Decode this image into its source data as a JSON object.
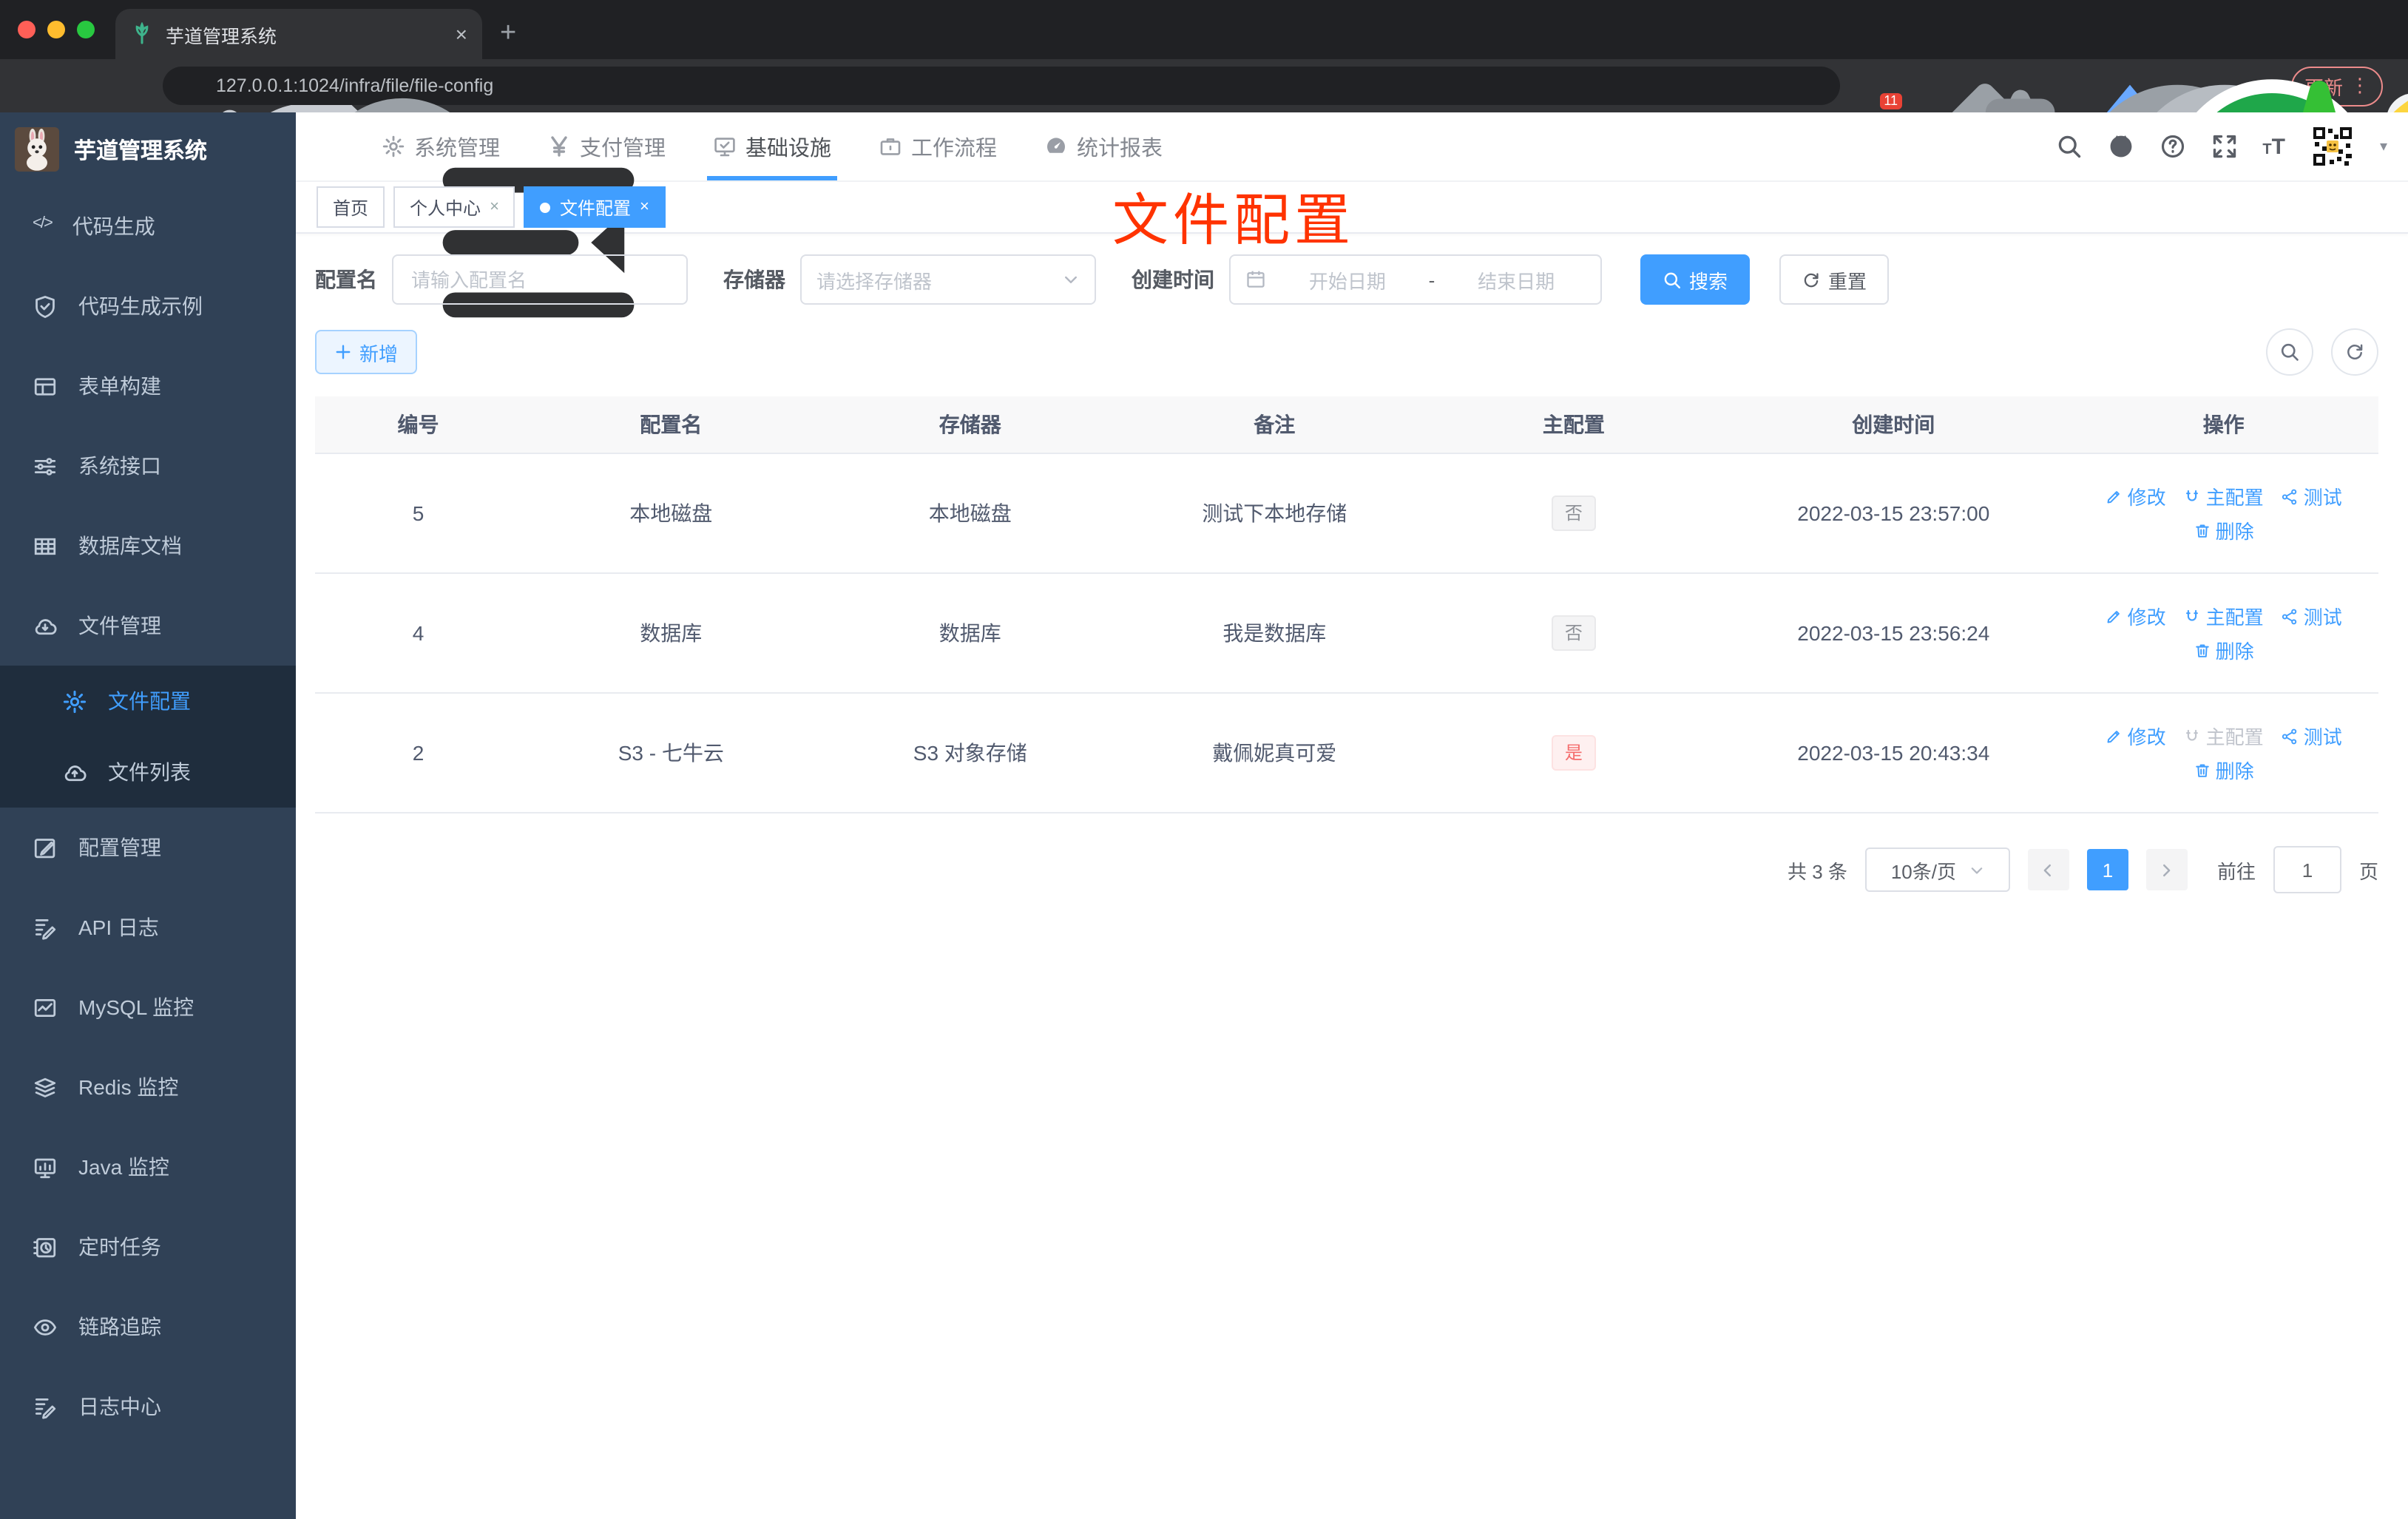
{
  "browser": {
    "tab_title": "芋道管理系统",
    "tab_close": "×",
    "new_tab": "+",
    "url": "127.0.0.1:1024/infra/file/file-config",
    "extension_badge": "11",
    "update_label": "更新",
    "kebab": "⋮",
    "traffic_colors": {
      "close": "#ff5f57",
      "minimize": "#febc2e",
      "zoom": "#28c840"
    }
  },
  "header": {
    "nav": [
      {
        "label": "系统管理",
        "icon": "gear-icon"
      },
      {
        "label": "支付管理",
        "icon": "yen-icon"
      },
      {
        "label": "基础设施",
        "icon": "monitor-check-icon",
        "active": true
      },
      {
        "label": "工作流程",
        "icon": "briefcase-icon"
      },
      {
        "label": "统计报表",
        "icon": "gauge-icon"
      }
    ]
  },
  "tabs": [
    {
      "label": "首页"
    },
    {
      "label": "个人中心",
      "close": "×"
    },
    {
      "label": "文件配置",
      "close": "×",
      "active": true
    }
  ],
  "annotation": {
    "text": "文件配置",
    "color": "#ff3300"
  },
  "sidebar": {
    "title": "芋道管理系统",
    "items": [
      {
        "label": "代码生成",
        "icon": "code-icon"
      },
      {
        "label": "代码生成示例",
        "icon": "shield-check-icon"
      },
      {
        "label": "表单构建",
        "icon": "form-grid-icon"
      },
      {
        "label": "系统接口",
        "icon": "sliders-icon"
      },
      {
        "label": "数据库文档",
        "icon": "table-grid-icon"
      },
      {
        "label": "文件管理",
        "icon": "cloud-download-icon",
        "expanded": true,
        "children": [
          {
            "label": "文件配置",
            "icon": "gear-icon",
            "active": true
          },
          {
            "label": "文件列表",
            "icon": "cloud-upload-icon"
          }
        ]
      },
      {
        "label": "配置管理",
        "icon": "edit-square-icon"
      },
      {
        "label": "API 日志",
        "icon": "doc-edit-icon",
        "collapsed": true
      },
      {
        "label": "MySQL 监控",
        "icon": "chart-line-icon"
      },
      {
        "label": "Redis 监控",
        "icon": "layers-icon"
      },
      {
        "label": "Java 监控",
        "icon": "monitor-bars-icon"
      },
      {
        "label": "定时任务",
        "icon": "schedule-icon"
      },
      {
        "label": "链路追踪",
        "icon": "eye-icon"
      },
      {
        "label": "日志中心",
        "icon": "log-edit-icon"
      }
    ]
  },
  "filters": {
    "name_label": "配置名",
    "name_placeholder": "请输入配置名",
    "storage_label": "存储器",
    "storage_placeholder": "请选择存储器",
    "date_label": "创建时间",
    "date_start": "开始日期",
    "date_sep": "-",
    "date_end": "结束日期",
    "search": "搜索",
    "reset": "重置"
  },
  "toolbar": {
    "add": "新增"
  },
  "table": {
    "headers": [
      "编号",
      "配置名",
      "存储器",
      "备注",
      "主配置",
      "创建时间",
      "操作"
    ],
    "action_labels": {
      "edit": "修改",
      "master": "主配置",
      "test": "测试",
      "delete": "删除"
    },
    "rows": [
      {
        "id": "5",
        "name": "本地磁盘",
        "storage": "本地磁盘",
        "remark": "测试下本地存储",
        "master": "否",
        "master_type": "info",
        "created": "2022-03-15 23:57:00",
        "master_action_disabled": false
      },
      {
        "id": "4",
        "name": "数据库",
        "storage": "数据库",
        "remark": "我是数据库",
        "master": "否",
        "master_type": "info",
        "created": "2022-03-15 23:56:24",
        "master_action_disabled": false
      },
      {
        "id": "2",
        "name": "S3 - 七牛云",
        "storage": "S3 对象存储",
        "remark": "戴佩妮真可爱",
        "master": "是",
        "master_type": "danger",
        "created": "2022-03-15 20:43:34",
        "master_action_disabled": true
      }
    ]
  },
  "pagination": {
    "total": "共 3 条",
    "page_size": "10条/页",
    "current": "1",
    "goto": "前往",
    "page_value": "1",
    "page_suffix": "页"
  },
  "colors": {
    "primary": "#409eff",
    "danger": "#f56c6c",
    "sidebar_bg": "#304156",
    "submenu_bg": "#1f2d3d"
  }
}
